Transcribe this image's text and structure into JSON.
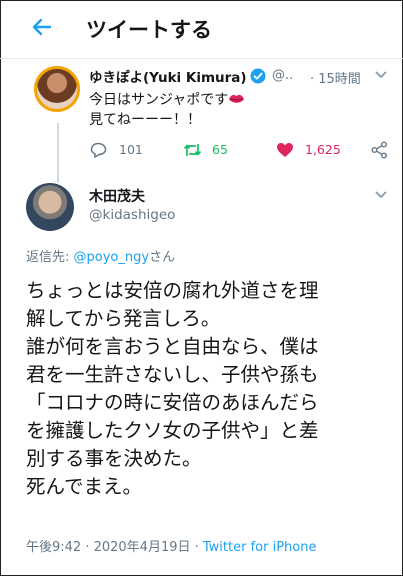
{
  "header": {
    "title": "ツイートする"
  },
  "parent_tweet": {
    "display_name": "ゆきぽよ(Yuki Kimura)",
    "handle": "@..",
    "time": "· 15時間",
    "text": "今日はサンジャポです\n見てねーーー！！",
    "reply_count": "101",
    "retweet_count": "65",
    "like_count": "1,625",
    "icons": [
      "verified-icon",
      "lips-emoji",
      "reply-icon",
      "retweet-icon",
      "heart-icon",
      "share-icon",
      "chevron-down-icon"
    ]
  },
  "main_tweet": {
    "display_name": "木田茂夫",
    "handle": "@kidashigeo",
    "reply_to_prefix": "返信先: ",
    "reply_to_user": "@poyo_ngy",
    "reply_to_suffix": "さん",
    "body_lines": [
      "ちょっとは安倍の腐れ外道さを理",
      "解してから発言しろ。",
      "誰が何を言おうと自由なら、僕は",
      "君を一生許さないし、子供や孫も",
      "「コロナの時に安倍のあほんだら",
      "を擁護したクソ女の子供や」と差",
      "別する事を決めた。",
      "死んでまえ。"
    ],
    "timestamp": "午後9:42 · 2020年4月19日 · ",
    "client": "Twitter for iPhone"
  },
  "colors": {
    "accent": "#1da1f2",
    "retweet": "#17bf63",
    "like": "#e0245e",
    "secondary_text": "#657786"
  }
}
